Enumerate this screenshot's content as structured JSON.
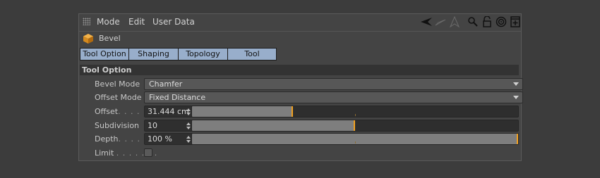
{
  "menu": {
    "mode": "Mode",
    "edit": "Edit",
    "user_data": "User Data"
  },
  "toolbar_icons": [
    "arrow-left-icon",
    "arrow-right-icon",
    "arrow-up-icon",
    "search-icon",
    "lock-icon",
    "target-icon",
    "new-window-icon"
  ],
  "object": {
    "title": "Bevel",
    "icon": "cube-icon"
  },
  "tabs": [
    {
      "label": "Tool Option",
      "active": true
    },
    {
      "label": "Shaping",
      "active": false
    },
    {
      "label": "Topology",
      "active": false
    },
    {
      "label": "Tool",
      "active": false
    }
  ],
  "section": {
    "title": "Tool Option"
  },
  "params": {
    "bevel_mode": {
      "label": "Bevel Mode",
      "value": "Chamfer"
    },
    "offset_mode": {
      "label": "Offset Mode",
      "value": "Fixed Distance"
    },
    "offset": {
      "label": "Offset",
      "dots": ". . . . .",
      "value": "31.444 cm",
      "slider_fraction": 0.31
    },
    "subdivision": {
      "label": "Subdivision",
      "value": "10",
      "slider_fraction": 0.5
    },
    "depth": {
      "label": "Depth",
      "dots": ". . . . . .",
      "value": "100 %",
      "slider_fraction": 1.0
    },
    "limit": {
      "label": "Limit",
      "dots": ". . . . . . .",
      "checked": false
    }
  },
  "colors": {
    "tab_bg": "#98aecb",
    "slider_knob": "#f0a020",
    "panel_bg": "#444444"
  }
}
